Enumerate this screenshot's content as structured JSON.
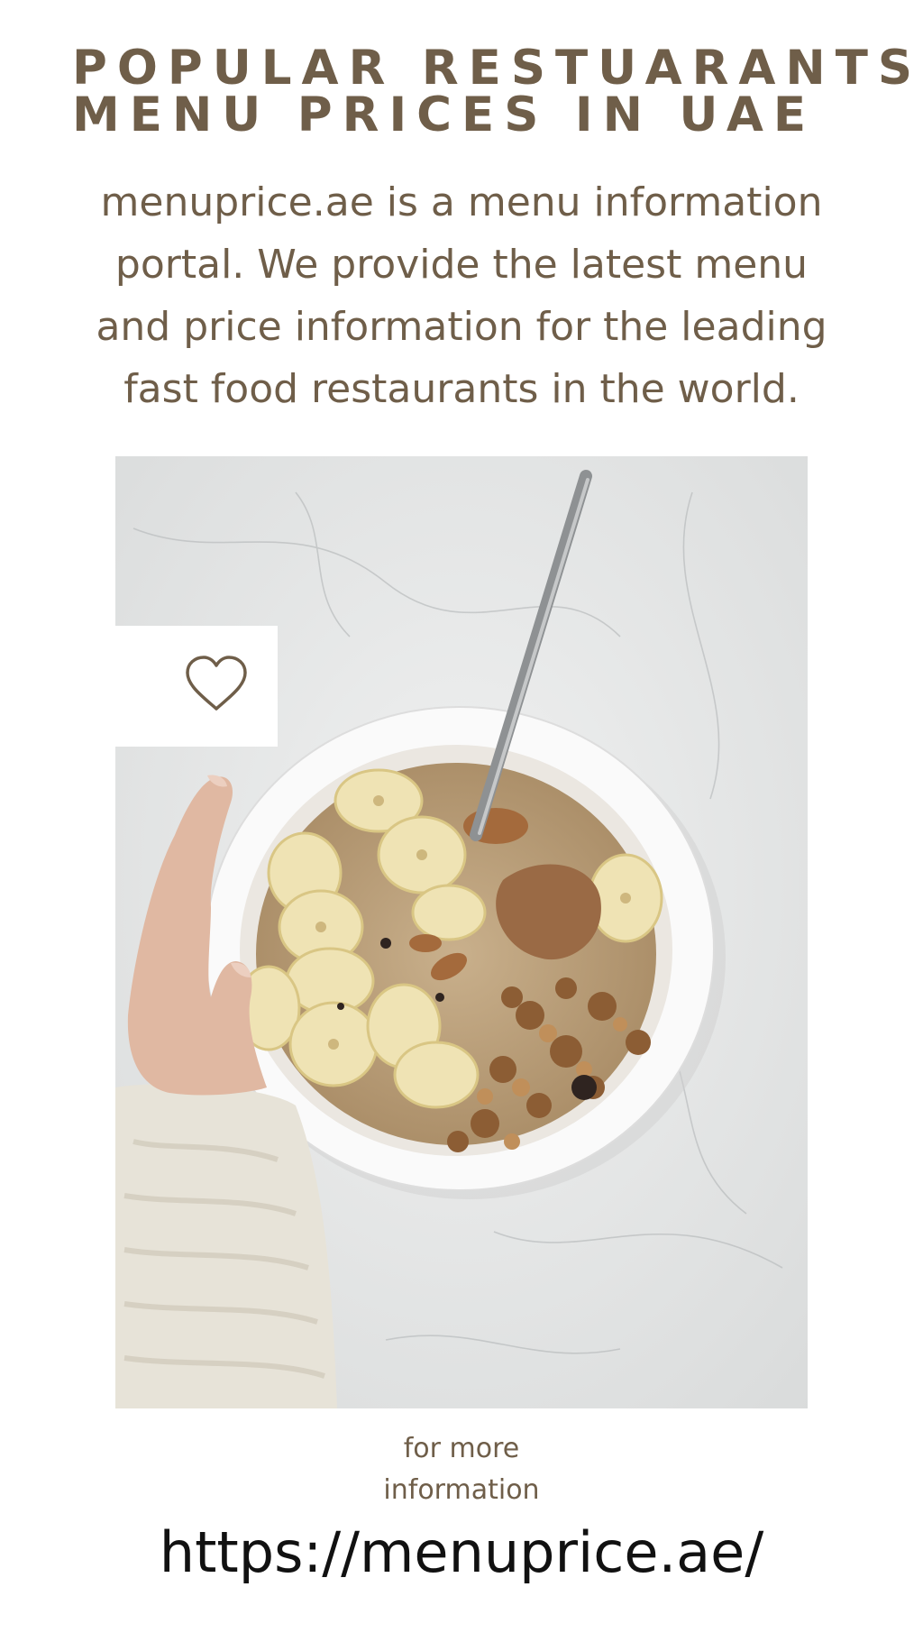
{
  "headline": {
    "line1": "POPULAR RESTUARANTS",
    "line2": "MENU PRICES IN UAE"
  },
  "intro": {
    "line1": "menuprice.ae is a menu information",
    "line2": "portal. We provide the latest menu",
    "line3": "and price information for the leading",
    "line4": "fast food restaurants in the world."
  },
  "photo": {
    "icon": "heart-icon"
  },
  "more_info": {
    "line1": "for more",
    "line2": "information"
  },
  "url": "https://menuprice.ae/",
  "colors": {
    "heading": "#6f5e49",
    "url": "#111111",
    "background": "#ffffff"
  }
}
